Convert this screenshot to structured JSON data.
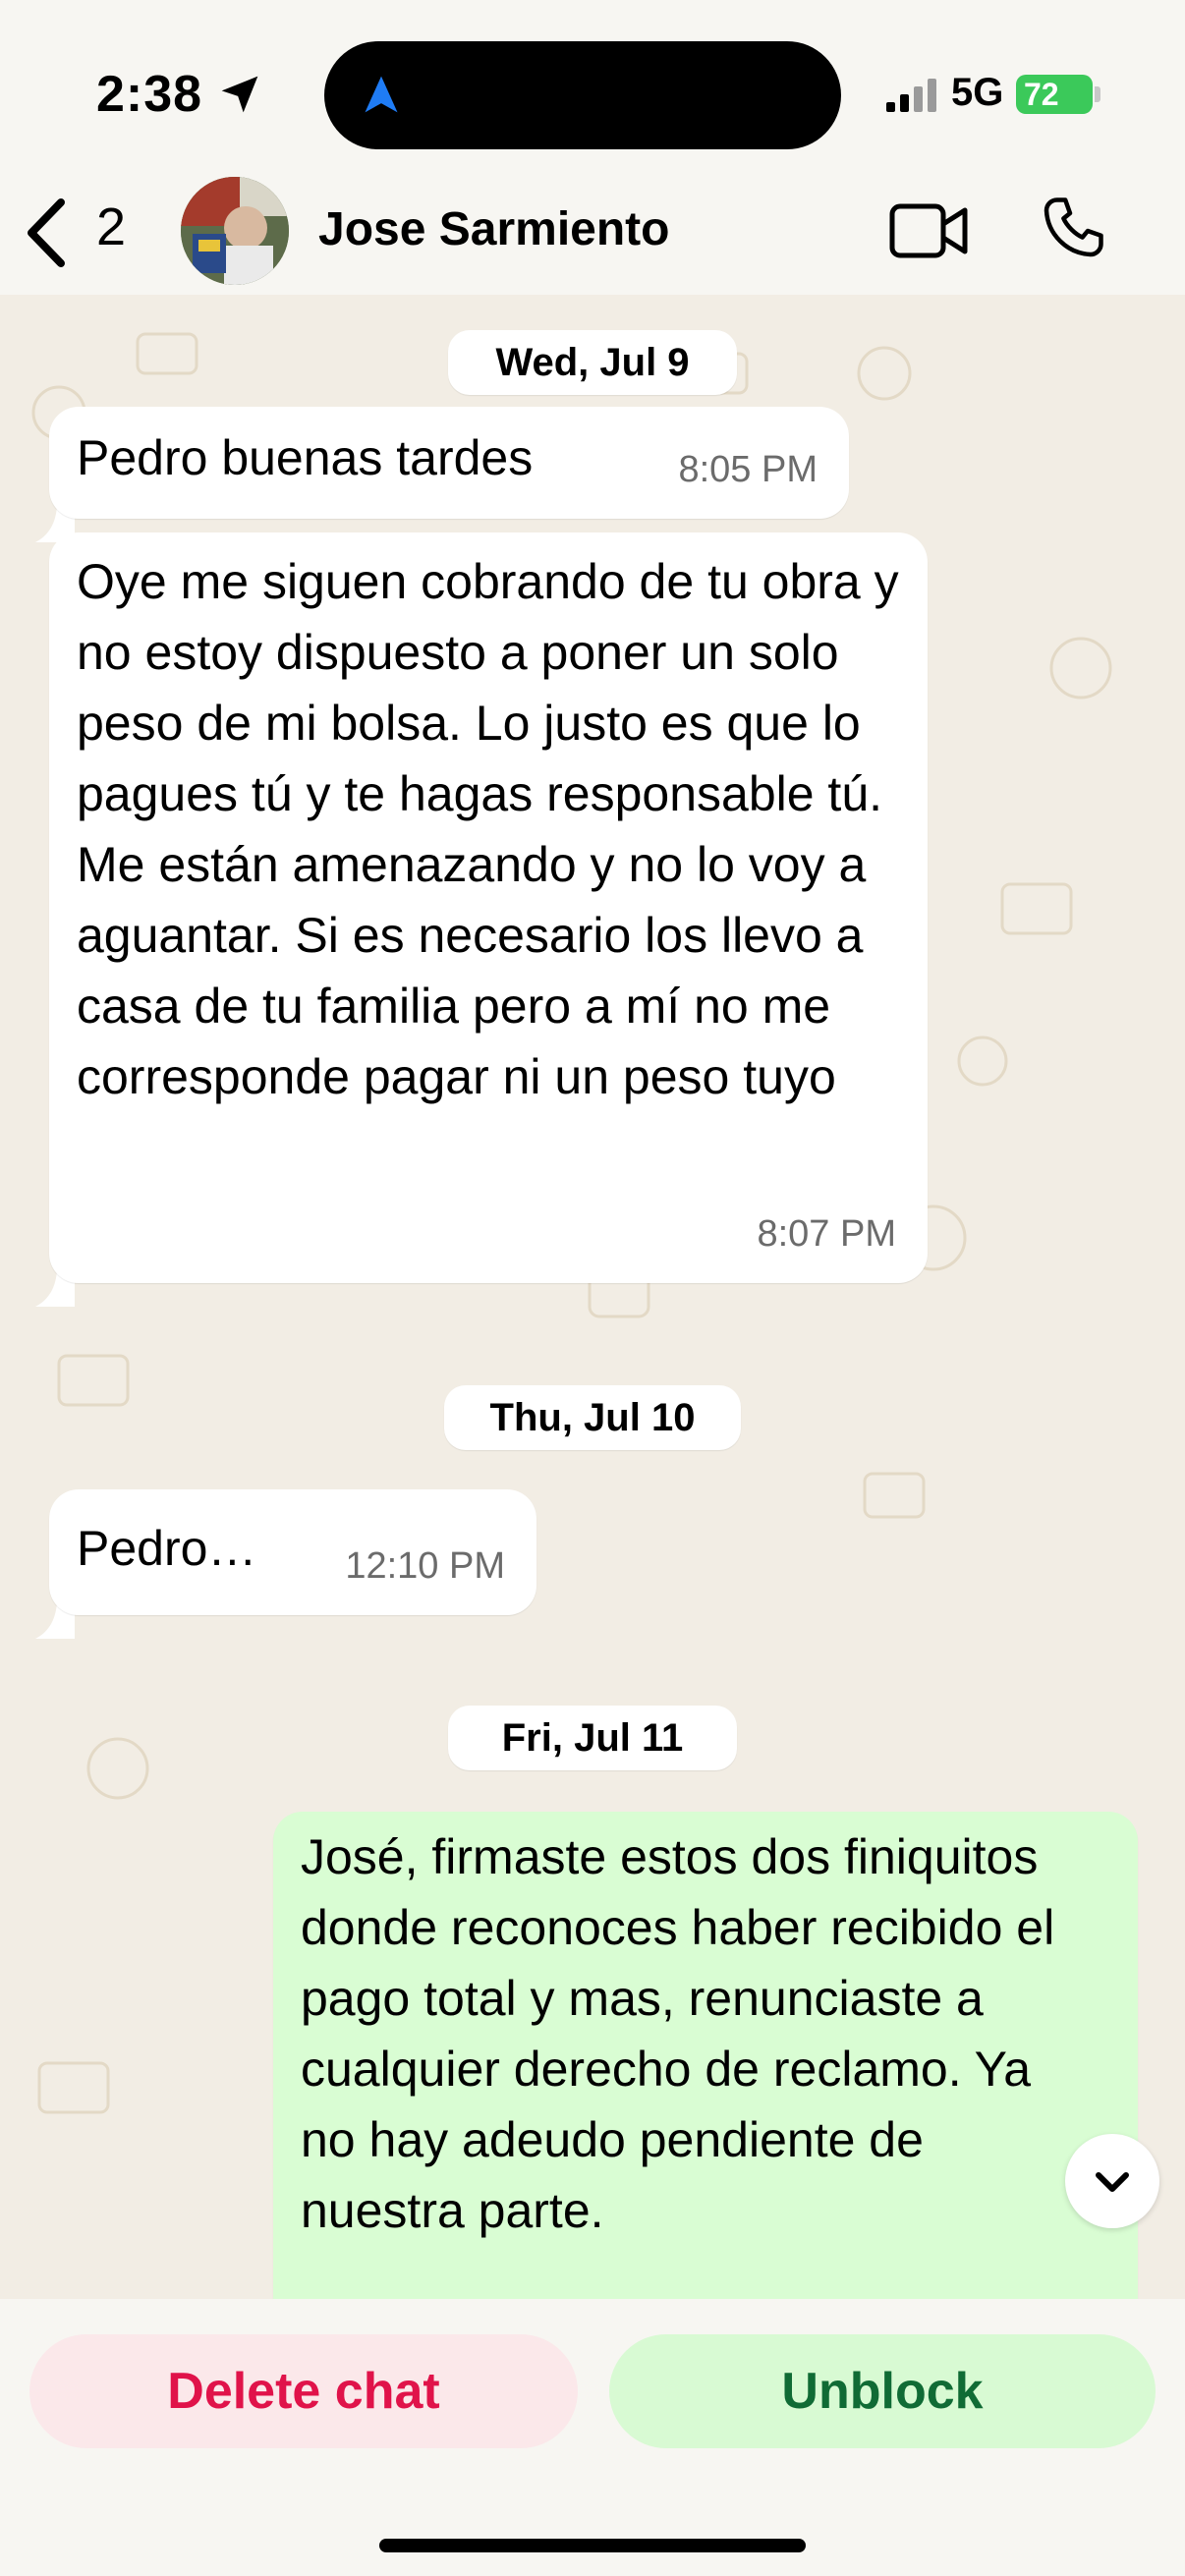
{
  "status_bar": {
    "time": "2:38",
    "network": "5G",
    "battery": "72"
  },
  "header": {
    "back_count": "2",
    "contact_name": "Jose Sarmiento"
  },
  "messages": [
    {
      "type": "date",
      "text": "Wed, Jul 9"
    },
    {
      "type": "incoming",
      "text": "Pedro buenas tardes",
      "time": "8:05 PM"
    },
    {
      "type": "incoming",
      "text": "Oye me siguen cobrando de tu obra y no estoy dispuesto a poner un solo peso de mi bolsa. Lo justo es que lo pagues tú y te hagas responsable tú. Me están amenazando y no lo voy a aguantar. Si es necesario los llevo a casa de tu familia pero a mí no me corresponde pagar ni un peso tuyo",
      "time": "8:07 PM"
    },
    {
      "type": "date",
      "text": "Thu, Jul 10"
    },
    {
      "type": "incoming",
      "text": "Pedro…",
      "time": "12:10 PM"
    },
    {
      "type": "date",
      "text": "Fri, Jul 11"
    },
    {
      "type": "outgoing",
      "text": "José, firmaste estos dos finiquitos donde reconoces haber recibido el pago total y mas, renunciaste a cualquier derecho de reclamo. Ya no hay adeudo pendiente de nuestra parte."
    }
  ],
  "actions": {
    "delete_label": "Delete chat",
    "unblock_label": "Unblock"
  },
  "colors": {
    "incoming_bubble": "#ffffff",
    "outgoing_bubble": "#d9fdd3",
    "delete_text": "#e0134a",
    "unblock_text": "#106b35",
    "battery": "#3bc95a"
  }
}
